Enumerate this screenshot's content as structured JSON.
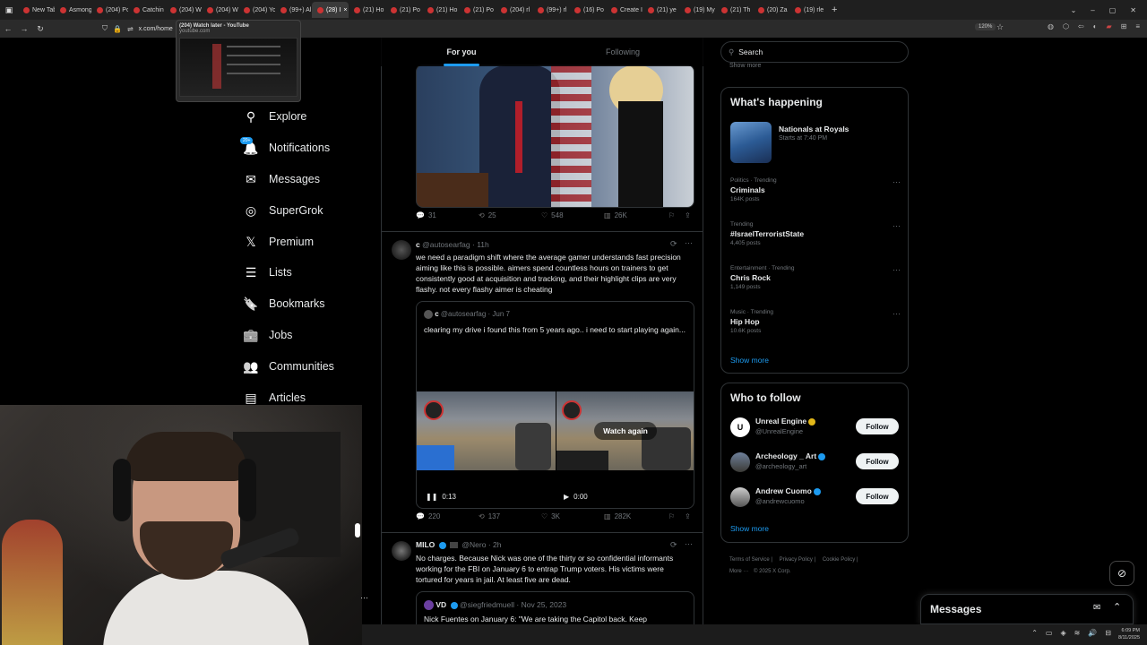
{
  "browser": {
    "tabs": [
      {
        "label": "New Tab",
        "active": false
      },
      {
        "label": "Asmong",
        "active": false
      },
      {
        "label": "(204) Po",
        "active": false
      },
      {
        "label": "Catchin",
        "active": false
      },
      {
        "label": "(204) W",
        "active": false
      },
      {
        "label": "(204) W",
        "active": false
      },
      {
        "label": "(204) Yo",
        "active": false
      },
      {
        "label": "(99+) Al",
        "active": false
      },
      {
        "label": "(28) I",
        "active": true
      },
      {
        "label": "(21) Ho",
        "active": false
      },
      {
        "label": "(21) Po",
        "active": false
      },
      {
        "label": "(21) Ho",
        "active": false
      },
      {
        "label": "(21) Po",
        "active": false
      },
      {
        "label": "(204) rl",
        "active": false
      },
      {
        "label": "(99+) rl",
        "active": false
      },
      {
        "label": "(16) Po",
        "active": false
      },
      {
        "label": "Create I",
        "active": false
      },
      {
        "label": "(21) ye",
        "active": false
      },
      {
        "label": "(19) My",
        "active": false
      },
      {
        "label": "(21) Th",
        "active": false
      },
      {
        "label": "(20) Za",
        "active": false
      },
      {
        "label": "(19) rle",
        "active": false
      }
    ],
    "close_tab": "×",
    "new_tab": "+",
    "url": "x.com/home",
    "zoom": "120%",
    "tooltip_title": "(204) Watch later - YouTube",
    "tooltip_url": "youtube.com"
  },
  "nav": {
    "items": [
      {
        "label": "Explore",
        "icon": "search-icon",
        "glyph": "⚲"
      },
      {
        "label": "Notifications",
        "icon": "bell-icon",
        "glyph": "🔔",
        "badge": "20+"
      },
      {
        "label": "Messages",
        "icon": "envelope-icon",
        "glyph": "✉"
      },
      {
        "label": "SuperGrok",
        "icon": "grok-icon",
        "glyph": "◎"
      },
      {
        "label": "Premium",
        "icon": "x-logo-icon",
        "glyph": "𝕏"
      },
      {
        "label": "Lists",
        "icon": "list-icon",
        "glyph": "☰"
      },
      {
        "label": "Bookmarks",
        "icon": "bookmark-icon",
        "glyph": "🔖"
      },
      {
        "label": "Jobs",
        "icon": "briefcase-icon",
        "glyph": "💼"
      },
      {
        "label": "Communities",
        "icon": "people-icon",
        "glyph": "👥"
      },
      {
        "label": "Articles",
        "icon": "article-icon",
        "glyph": "▤"
      }
    ]
  },
  "feed": {
    "tab_for_you": "For you",
    "tab_following": "Following",
    "post1": {
      "replies": "31",
      "reposts": "25",
      "likes": "548",
      "views": "26K"
    },
    "post2": {
      "name": "c",
      "handle": "@autosearfag",
      "time": "· 11h",
      "text": "we need a paradigm shift where the average gamer understands fast precision aiming like this is possible. aimers spend countless hours on trainers to get consistently good at acquisition and tracking, and their highlight clips are very flashy. not every flashy aimer is cheating",
      "quote": {
        "name": "c",
        "handle": "@autosearfag",
        "time": "· Jun 7",
        "text": "clearing my drive i found this from 5 years ago.. i need to start playing again...",
        "watch_again": "Watch again",
        "time_left": "0:13",
        "time_right": "0:00"
      },
      "replies": "220",
      "reposts": "137",
      "likes": "3K",
      "views": "282K"
    },
    "post3": {
      "name": "MILO",
      "handle": "@Nero",
      "time": "· 2h",
      "text": "No charges. Because Nick was one of the thirty or so confidential informants working for the FBI on January 6 to entrap Trump voters. His victims were tortured for years in jail. At least five are dead.",
      "quote": {
        "name": "VD",
        "handle": "@siegfriedmuell",
        "time": "· Nov 25, 2023",
        "text": "Nick Fuentes on January 6: \"We are taking the Capitol back.  Keep"
      }
    }
  },
  "sidebar": {
    "search_placeholder": "Search",
    "show_more_top": "Show more",
    "happening_title": "What's happening",
    "event": {
      "name": "Nationals at Royals",
      "time": "Starts at 7:40 PM"
    },
    "trends": [
      {
        "category": "Politics · Trending",
        "name": "Criminals",
        "count": "164K posts"
      },
      {
        "category": "Trending",
        "name": "#IsraelTerroristState",
        "count": "4,405 posts"
      },
      {
        "category": "Entertainment · Trending",
        "name": "Chris Rock",
        "count": "1,149 posts"
      },
      {
        "category": "Music · Trending",
        "name": "Hip Hop",
        "count": "10.6K posts"
      }
    ],
    "show_more": "Show more",
    "who_title": "Who to follow",
    "who": [
      {
        "name": "Unreal Engine",
        "handle": "@UnrealEngine",
        "follow": "Follow"
      },
      {
        "name": "Archeology _ Art",
        "handle": "@archeology_art",
        "follow": "Follow"
      },
      {
        "name": "Andrew Cuomo",
        "handle": "@andrewcuomo",
        "follow": "Follow"
      }
    ],
    "who_show_more": "Show more",
    "footer": {
      "terms": "Terms of Service",
      "privacy": "Privacy Policy",
      "cookie": "Cookie Policy",
      "more": "More ···",
      "copyright": "© 2025 X Corp."
    }
  },
  "messages_drawer": {
    "title": "Messages"
  },
  "taskbar": {
    "time": "6:09 PM",
    "date": "8/11/2025"
  },
  "colors": {
    "accent": "#1d9bf0",
    "bg": "#000000",
    "border": "#2f3336",
    "muted": "#71767b"
  }
}
